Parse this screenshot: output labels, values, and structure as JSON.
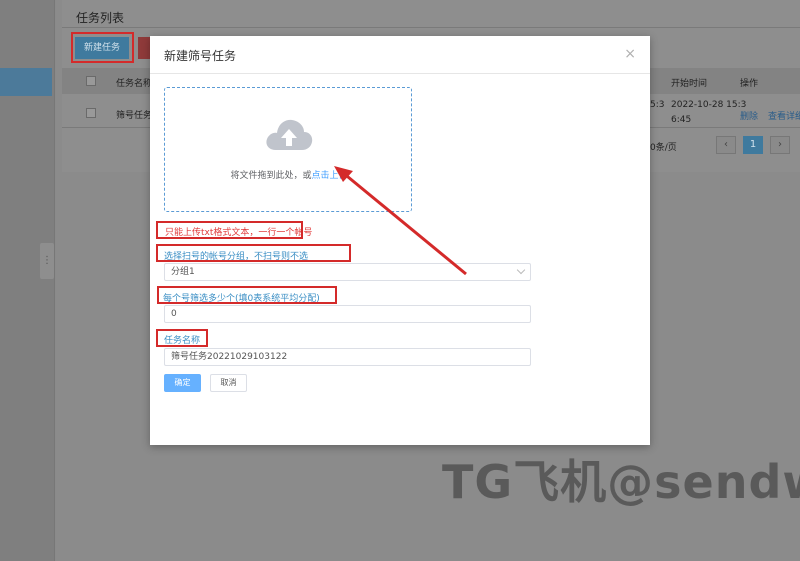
{
  "background": {
    "card_title": "任务列表",
    "new_task_button": "新建任务",
    "table": {
      "col_name": "任务名称",
      "col_start": "开始时间",
      "col_action": "操作",
      "row_name": "筛号任务",
      "row_start_line1": "2022-10-28 15:3",
      "row_start_line2": "6:45",
      "row_prev_time": "5:3",
      "action_delete": "删除",
      "action_detail": "查看详细"
    },
    "pagination": {
      "page_size": "0条/页",
      "current_page": "1"
    },
    "watermark": "TG飞机@sendw"
  },
  "modal": {
    "title": "新建筛号任务",
    "close": "×",
    "upload": {
      "text_before": "将文件拖到此处，或",
      "text_link": "点击上传",
      "icon": "cloud-upload-icon"
    },
    "tip_file": "只能上传txt格式文本，一行一个帐号",
    "label_group": "选择扫号的帐号分组，不扫号则不选",
    "group_value": "分组1",
    "label_count": "每个号筛选多少个(填0表系统平均分配)",
    "count_value": "0",
    "label_name": "任务名称",
    "name_value": "筛号任务20221029103122",
    "confirm": "确定",
    "cancel": "取消"
  },
  "colors": {
    "annotation": "#d42a2a",
    "primary": "#409eff",
    "overlay": "#8a8a8a"
  }
}
